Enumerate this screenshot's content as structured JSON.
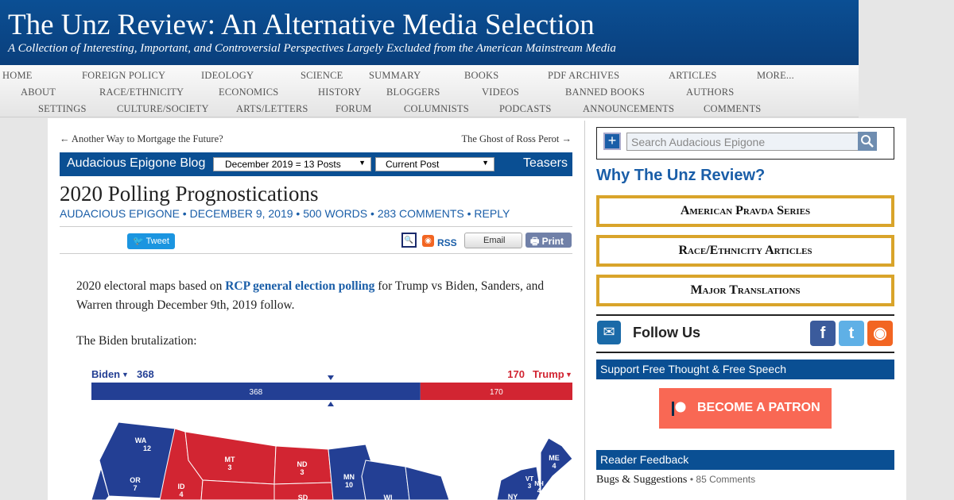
{
  "site": {
    "title": "The Unz Review: An Alternative Media Selection",
    "tagline": "A Collection of Interesting, Important, and Controversial Perspectives Largely Excluded from the American Mainstream Media"
  },
  "nav": {
    "row1": [
      "HOME",
      "FOREIGN POLICY",
      "IDEOLOGY",
      "SCIENCE",
      "SUMMARY",
      "BOOKS",
      "PDF ARCHIVES",
      "ARTICLES",
      "MORE..."
    ],
    "row2": [
      "ABOUT",
      "RACE/ETHNICITY",
      "ECONOMICS",
      "HISTORY",
      "BLOGGERS",
      "VIDEOS",
      "BANNED BOOKS",
      "AUTHORS"
    ],
    "row3": [
      "SETTINGS",
      "CULTURE/SOCIETY",
      "ARTS/LETTERS",
      "FORUM",
      "COLUMNISTS",
      "PODCASTS",
      "ANNOUNCEMENTS",
      "COMMENTS"
    ]
  },
  "post_nav": {
    "prev": "← Another Way to Mortgage the Future?",
    "next": "The Ghost of Ross Perot →"
  },
  "blog_bar": {
    "name": "Audacious Epigone Blog",
    "month_select": "December 2019 = 13 Posts",
    "post_select": "Current Post",
    "teasers": "Teasers"
  },
  "post": {
    "title": "2020 Polling Prognostications",
    "byline": "AUDACIOUS EPIGONE • DECEMBER 9, 2019 • 500 WORDS • 283 COMMENTS • REPLY",
    "p1_before": "2020 electoral maps based on ",
    "p1_link": "RCP general election polling",
    "p1_after": " for Trump vs Biden, Sanders, and Warren through December 9th, 2019 follow.",
    "p2": "The Biden brutalization:"
  },
  "share": {
    "tweet": "Tweet",
    "rss": "RSS",
    "email": "Email",
    "print": "Print",
    "icons": [
      "twitter-icon",
      "zoom-icon",
      "rss-icon",
      "email-icon",
      "print-icon"
    ]
  },
  "map": {
    "dem_label": "Biden",
    "dem_total": "368",
    "rep_label": "Trump",
    "rep_total": "170",
    "bar_dem": "368",
    "bar_rep": "170",
    "dem_ev": 368,
    "rep_ev": 170,
    "dem_color": "#233f94",
    "rep_color": "#d22532",
    "states": {
      "wa": {
        "abbr": "WA",
        "ev": "12"
      },
      "or": {
        "abbr": "OR",
        "ev": "7"
      },
      "id": {
        "abbr": "ID",
        "ev": "4"
      },
      "mt": {
        "abbr": "MT",
        "ev": "3"
      },
      "nd": {
        "abbr": "ND",
        "ev": "3"
      },
      "sd": {
        "abbr": "SD",
        "ev": ""
      },
      "mn": {
        "abbr": "MN",
        "ev": "10"
      },
      "wi": {
        "abbr": "WI",
        "ev": ""
      },
      "me": {
        "abbr": "ME",
        "ev": "4"
      },
      "vt": {
        "abbr": "VT",
        "ev": "3"
      },
      "nh": {
        "abbr": "NH",
        "ev": "4"
      },
      "ny": {
        "abbr": "NY",
        "ev": ""
      }
    }
  },
  "sidebar": {
    "search_placeholder": "Search Audacious Epigone",
    "why_unz": "Why The Unz Review?",
    "features": [
      "American Pravda Series",
      "Race/Ethnicity Articles",
      "Major Translations"
    ],
    "follow_us": "Follow Us",
    "social_icons": [
      "facebook-icon",
      "twitter-icon",
      "rss-icon"
    ],
    "support_bar": "Support Free Thought & Free Speech",
    "patron_button": "BECOME A PATRON",
    "feedback_bar": "Reader Feedback",
    "bugs_link": "Bugs & Suggestions",
    "bugs_count": "• 85 Comments"
  },
  "colors": {
    "brand_blue": "#0a4f93",
    "link_blue": "#1a5ea8",
    "gold": "#d9a42a",
    "patreon": "#f96854"
  }
}
